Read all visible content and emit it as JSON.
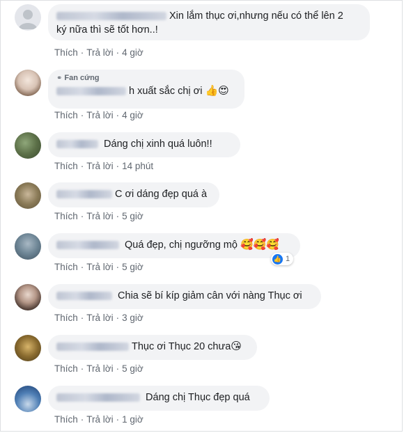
{
  "actions": {
    "like": "Thích",
    "reply": "Trả lời",
    "sep": "·"
  },
  "badge_label": "Fan cứng",
  "like_icon": "thumbs-up-icon",
  "comments": [
    {
      "text_line1": "Xin lắm thục ơi,nhưng nếu có thể lên 2",
      "text_line2": "ký nữa thì sẽ tốt hơn..!",
      "time": "4 giờ"
    },
    {
      "text": "h xuất sắc chị ơi",
      "emojis": "👍😍",
      "time": "4 giờ"
    },
    {
      "text": "Dáng chị xinh quá luôn!!",
      "time": "14 phút"
    },
    {
      "text": "C ơi dáng đẹp quá à",
      "time": "5 giờ"
    },
    {
      "text": "Quá đẹp, chị ngưỡng mộ",
      "emojis": "🥰🥰🥰",
      "reaction_count": "1",
      "time": "5 giờ"
    },
    {
      "text": "Chia sẽ bí kíp giảm cân với nàng Thục ơi",
      "time": "3 giờ"
    },
    {
      "text": "Thục ơi Thục 20 chưa",
      "emojis": "😘",
      "time": "5 giờ"
    },
    {
      "text": "Dáng chị Thục đẹp quá",
      "time": "1 giờ"
    }
  ]
}
